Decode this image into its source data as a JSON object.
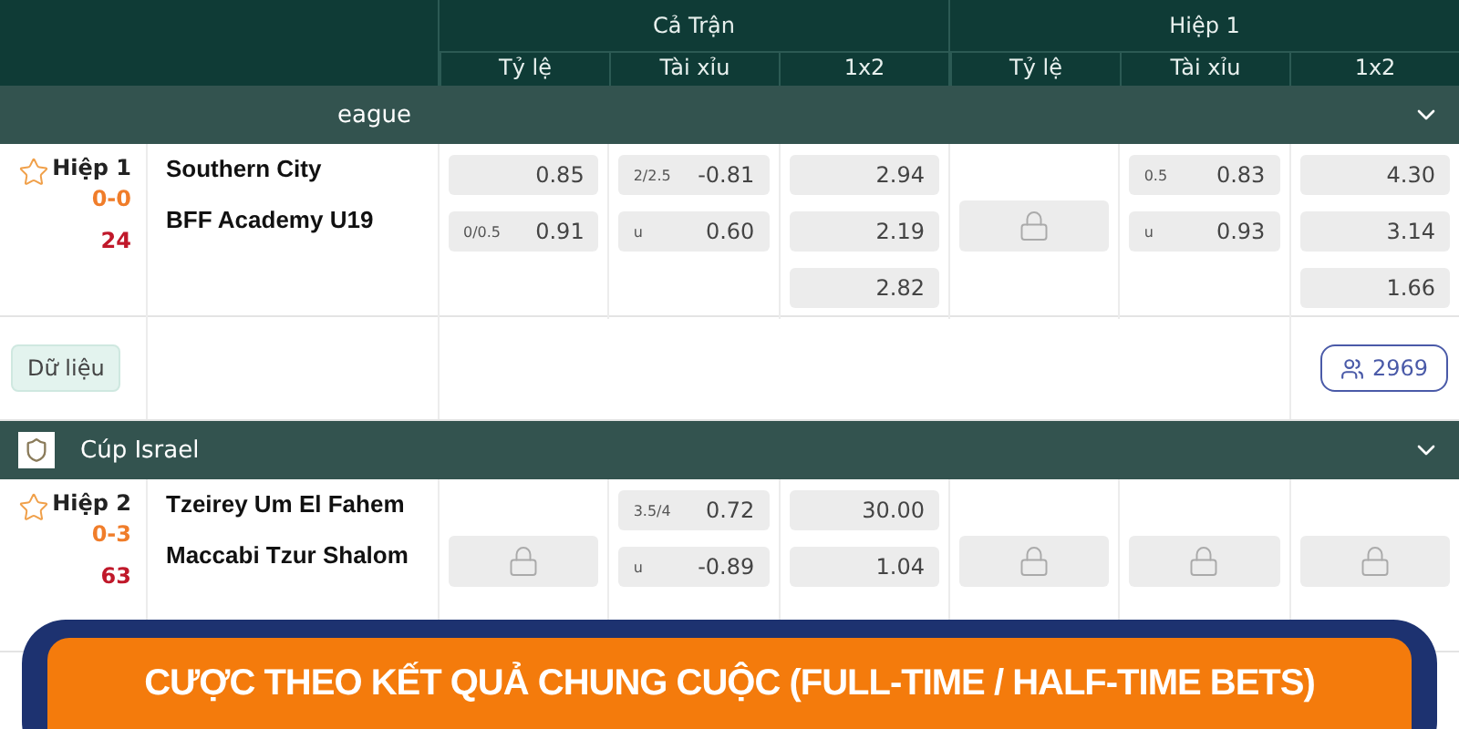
{
  "header": {
    "groups": [
      {
        "label": "Cả Trận",
        "columns": [
          "Tỷ lệ",
          "Tài xỉu",
          "1x2"
        ]
      },
      {
        "label": "Hiệp 1",
        "columns": [
          "Tỷ lệ",
          "Tài xỉu",
          "1x2"
        ]
      }
    ]
  },
  "leagues": [
    {
      "name": "eague",
      "has_logo": false,
      "expanded": true,
      "matches": [
        {
          "period": "Hiệp 1",
          "score": "0-0",
          "minute": "24",
          "favorite": false,
          "home": "Southern City",
          "away": "BFF Academy U19",
          "markets": [
            {
              "kind": "odds",
              "odds": [
                {
                  "value": "0.85"
                },
                {
                  "line": "0/0.5",
                  "value": "0.91"
                }
              ]
            },
            {
              "kind": "odds",
              "odds": [
                {
                  "line": "2/2.5",
                  "value": "-0.81"
                },
                {
                  "line": "u",
                  "value": "0.60"
                }
              ]
            },
            {
              "kind": "odds",
              "odds": [
                {
                  "value": "2.94"
                },
                {
                  "value": "2.19"
                },
                {
                  "value": "2.82"
                }
              ]
            },
            {
              "kind": "locked"
            },
            {
              "kind": "odds",
              "odds": [
                {
                  "line": "0.5",
                  "value": "0.83"
                },
                {
                  "line": "u",
                  "value": "0.93"
                }
              ]
            },
            {
              "kind": "odds",
              "odds": [
                {
                  "value": "4.30"
                },
                {
                  "value": "3.14"
                },
                {
                  "value": "1.66"
                }
              ]
            }
          ],
          "footer": {
            "data_button": "Dữ liệu",
            "viewers": "2969"
          }
        }
      ]
    },
    {
      "name": "Cúp Israel",
      "has_logo": true,
      "expanded": true,
      "matches": [
        {
          "period": "Hiệp 2",
          "score": "0-3",
          "minute": "63",
          "favorite": false,
          "home": "Tzeirey Um El Fahem",
          "away": "Maccabi Tzur Shalom",
          "markets": [
            {
              "kind": "locked"
            },
            {
              "kind": "odds",
              "odds": [
                {
                  "line": "3.5/4",
                  "value": "0.72"
                },
                {
                  "line": "u",
                  "value": "-0.89"
                }
              ]
            },
            {
              "kind": "odds",
              "odds": [
                {
                  "value": "30.00"
                },
                {
                  "value": "1.04"
                }
              ]
            },
            {
              "kind": "locked"
            },
            {
              "kind": "locked"
            },
            {
              "kind": "locked"
            }
          ]
        }
      ]
    }
  ],
  "banner": {
    "text": "CƯỢC THEO KẾT QUẢ CHUNG CUỘC (FULL-TIME / HALF-TIME BETS)"
  }
}
